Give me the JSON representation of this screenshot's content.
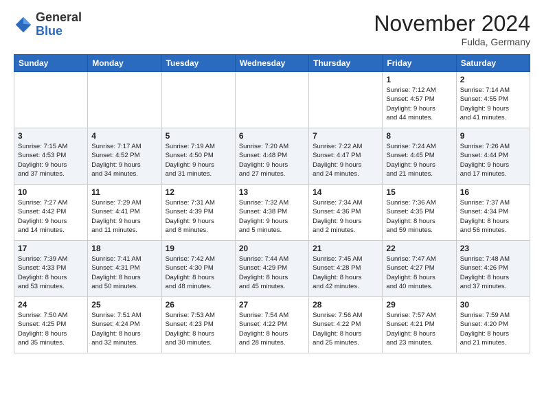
{
  "header": {
    "logo_general": "General",
    "logo_blue": "Blue",
    "month_title": "November 2024",
    "location": "Fulda, Germany"
  },
  "weekdays": [
    "Sunday",
    "Monday",
    "Tuesday",
    "Wednesday",
    "Thursday",
    "Friday",
    "Saturday"
  ],
  "weeks": [
    [
      {
        "day": "",
        "info": ""
      },
      {
        "day": "",
        "info": ""
      },
      {
        "day": "",
        "info": ""
      },
      {
        "day": "",
        "info": ""
      },
      {
        "day": "",
        "info": ""
      },
      {
        "day": "1",
        "info": "Sunrise: 7:12 AM\nSunset: 4:57 PM\nDaylight: 9 hours\nand 44 minutes."
      },
      {
        "day": "2",
        "info": "Sunrise: 7:14 AM\nSunset: 4:55 PM\nDaylight: 9 hours\nand 41 minutes."
      }
    ],
    [
      {
        "day": "3",
        "info": "Sunrise: 7:15 AM\nSunset: 4:53 PM\nDaylight: 9 hours\nand 37 minutes."
      },
      {
        "day": "4",
        "info": "Sunrise: 7:17 AM\nSunset: 4:52 PM\nDaylight: 9 hours\nand 34 minutes."
      },
      {
        "day": "5",
        "info": "Sunrise: 7:19 AM\nSunset: 4:50 PM\nDaylight: 9 hours\nand 31 minutes."
      },
      {
        "day": "6",
        "info": "Sunrise: 7:20 AM\nSunset: 4:48 PM\nDaylight: 9 hours\nand 27 minutes."
      },
      {
        "day": "7",
        "info": "Sunrise: 7:22 AM\nSunset: 4:47 PM\nDaylight: 9 hours\nand 24 minutes."
      },
      {
        "day": "8",
        "info": "Sunrise: 7:24 AM\nSunset: 4:45 PM\nDaylight: 9 hours\nand 21 minutes."
      },
      {
        "day": "9",
        "info": "Sunrise: 7:26 AM\nSunset: 4:44 PM\nDaylight: 9 hours\nand 17 minutes."
      }
    ],
    [
      {
        "day": "10",
        "info": "Sunrise: 7:27 AM\nSunset: 4:42 PM\nDaylight: 9 hours\nand 14 minutes."
      },
      {
        "day": "11",
        "info": "Sunrise: 7:29 AM\nSunset: 4:41 PM\nDaylight: 9 hours\nand 11 minutes."
      },
      {
        "day": "12",
        "info": "Sunrise: 7:31 AM\nSunset: 4:39 PM\nDaylight: 9 hours\nand 8 minutes."
      },
      {
        "day": "13",
        "info": "Sunrise: 7:32 AM\nSunset: 4:38 PM\nDaylight: 9 hours\nand 5 minutes."
      },
      {
        "day": "14",
        "info": "Sunrise: 7:34 AM\nSunset: 4:36 PM\nDaylight: 9 hours\nand 2 minutes."
      },
      {
        "day": "15",
        "info": "Sunrise: 7:36 AM\nSunset: 4:35 PM\nDaylight: 8 hours\nand 59 minutes."
      },
      {
        "day": "16",
        "info": "Sunrise: 7:37 AM\nSunset: 4:34 PM\nDaylight: 8 hours\nand 56 minutes."
      }
    ],
    [
      {
        "day": "17",
        "info": "Sunrise: 7:39 AM\nSunset: 4:33 PM\nDaylight: 8 hours\nand 53 minutes."
      },
      {
        "day": "18",
        "info": "Sunrise: 7:41 AM\nSunset: 4:31 PM\nDaylight: 8 hours\nand 50 minutes."
      },
      {
        "day": "19",
        "info": "Sunrise: 7:42 AM\nSunset: 4:30 PM\nDaylight: 8 hours\nand 48 minutes."
      },
      {
        "day": "20",
        "info": "Sunrise: 7:44 AM\nSunset: 4:29 PM\nDaylight: 8 hours\nand 45 minutes."
      },
      {
        "day": "21",
        "info": "Sunrise: 7:45 AM\nSunset: 4:28 PM\nDaylight: 8 hours\nand 42 minutes."
      },
      {
        "day": "22",
        "info": "Sunrise: 7:47 AM\nSunset: 4:27 PM\nDaylight: 8 hours\nand 40 minutes."
      },
      {
        "day": "23",
        "info": "Sunrise: 7:48 AM\nSunset: 4:26 PM\nDaylight: 8 hours\nand 37 minutes."
      }
    ],
    [
      {
        "day": "24",
        "info": "Sunrise: 7:50 AM\nSunset: 4:25 PM\nDaylight: 8 hours\nand 35 minutes."
      },
      {
        "day": "25",
        "info": "Sunrise: 7:51 AM\nSunset: 4:24 PM\nDaylight: 8 hours\nand 32 minutes."
      },
      {
        "day": "26",
        "info": "Sunrise: 7:53 AM\nSunset: 4:23 PM\nDaylight: 8 hours\nand 30 minutes."
      },
      {
        "day": "27",
        "info": "Sunrise: 7:54 AM\nSunset: 4:22 PM\nDaylight: 8 hours\nand 28 minutes."
      },
      {
        "day": "28",
        "info": "Sunrise: 7:56 AM\nSunset: 4:22 PM\nDaylight: 8 hours\nand 25 minutes."
      },
      {
        "day": "29",
        "info": "Sunrise: 7:57 AM\nSunset: 4:21 PM\nDaylight: 8 hours\nand 23 minutes."
      },
      {
        "day": "30",
        "info": "Sunrise: 7:59 AM\nSunset: 4:20 PM\nDaylight: 8 hours\nand 21 minutes."
      }
    ]
  ]
}
